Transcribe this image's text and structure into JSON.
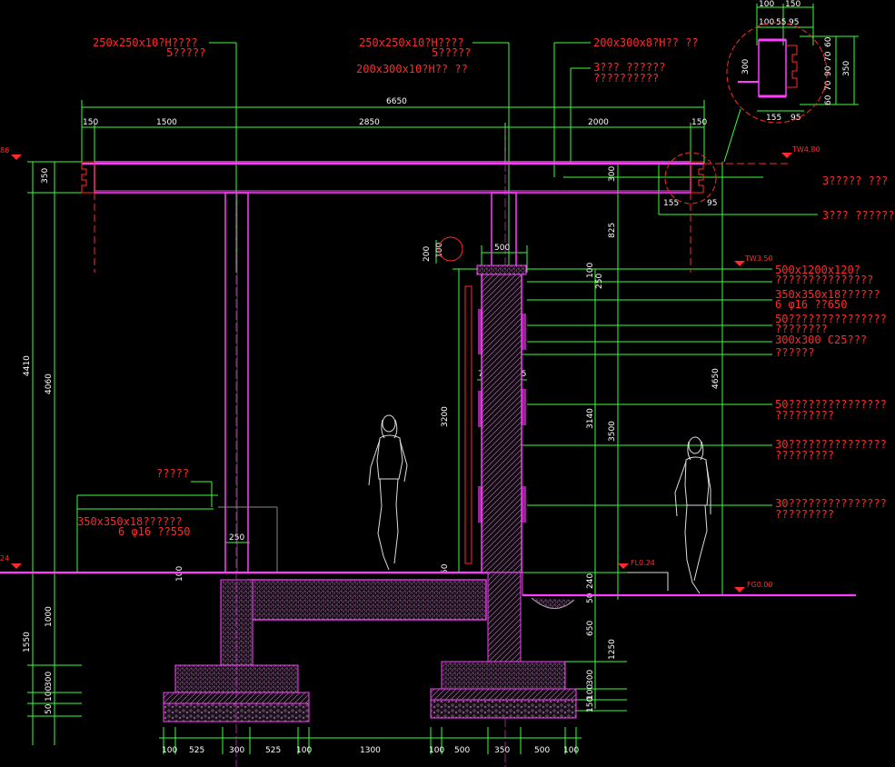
{
  "notes": [
    "250x250x10?H????",
    "5?????",
    "250x250x10?H????",
    "5?????",
    "200x300x10?H?? ??",
    "200x300x8?H?? ??",
    "3??? ??????",
    "??????????",
    "3????? ???",
    "3??? ??????",
    "500x1200x120?",
    "???????????????",
    "350x350x18??????",
    "6 φ16 ??650",
    "50???????????????",
    "????????",
    "300x300 C25???",
    "??????",
    "50???????????????",
    "?????????",
    "30???????????????",
    "?????????",
    "30???????????????",
    "?????????",
    "?????",
    "350x350x18??????",
    "6 φ16 ??550"
  ],
  "elevations": [
    "TW4.80",
    "TW3.50",
    "FL0.24",
    "FG0.00",
    "86",
    "24"
  ],
  "dims_top": [
    "6650",
    "150",
    "1500",
    "2850",
    "2000",
    "150",
    "300"
  ],
  "dims_detail": [
    "100",
    "150",
    "100",
    "55",
    "95",
    "300",
    "60",
    "70",
    "90",
    "70",
    "60",
    "350",
    "155",
    "95",
    "155",
    "95"
  ],
  "dims_left": [
    "350",
    "4410",
    "4060",
    "1000",
    "1550",
    "300",
    "100",
    "50",
    "100",
    "250"
  ],
  "dims_mid": [
    "200",
    "100",
    "500",
    "100",
    "250",
    "75",
    "350",
    "75",
    "3200",
    "50",
    "825",
    "3140",
    "3500",
    "4650",
    "240",
    "50",
    "650",
    "1250",
    "300",
    "100",
    "150"
  ],
  "dims_bottom": [
    "100",
    "525",
    "300",
    "525",
    "100",
    "1300",
    "100",
    "500",
    "350",
    "500",
    "100"
  ]
}
